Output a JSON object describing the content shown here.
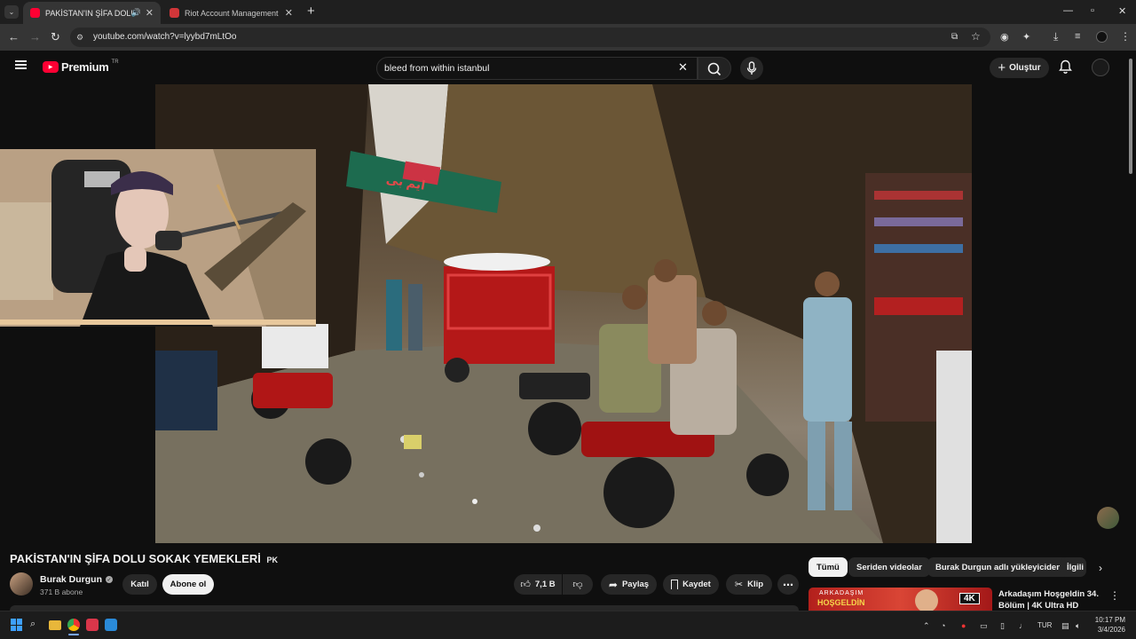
{
  "browser": {
    "tabs": [
      {
        "title": "PAKİSTAN'IN ŞİFA DOLU SO",
        "active": true
      },
      {
        "title": "Riot Account Management",
        "active": false
      }
    ],
    "new_tab": "+",
    "url": "youtube.com/watch?v=lyybd7mLtOo"
  },
  "youtube": {
    "logo_text": "Premium",
    "logo_region": "TR",
    "search_value": "bleed from within istanbul",
    "create_label": "Oluştur",
    "video_title": "PAKİSTAN'IN ŞİFA DOLU SOKAK YEMEKLERİ",
    "video_title_flag": "PK",
    "channel_name": "Burak Durgun",
    "subscribers": "371 B abone",
    "join_label": "Katıl",
    "subscribe_label": "Abone ol",
    "likes": "7,1 B",
    "share_label": "Paylaş",
    "save_label": "Kaydet",
    "clip_label": "Klip",
    "filter_chips": [
      "Tümü",
      "Seriden videolar",
      "Burak Durgun adlı yükleyiciden",
      "İlgili"
    ],
    "rec_title_1": "Arkadaşım Hoşgeldin 34.",
    "rec_title_2": "Bölüm | 4K Ultra HD",
    "rec_thumb_text": "ARKADAŞIM",
    "rec_thumb_text2": "HOŞGELDİN",
    "rec_badge": "4K"
  },
  "video_scene": {
    "banner_text": "ایم بی"
  },
  "taskbar": {
    "lang": "TUR",
    "time": "10:17 PM",
    "date": "3/4/2026"
  },
  "colors": {
    "yt_red": "#ff0033",
    "bg": "#0f0f0f",
    "chip_active_bg": "#f1f1f1"
  }
}
